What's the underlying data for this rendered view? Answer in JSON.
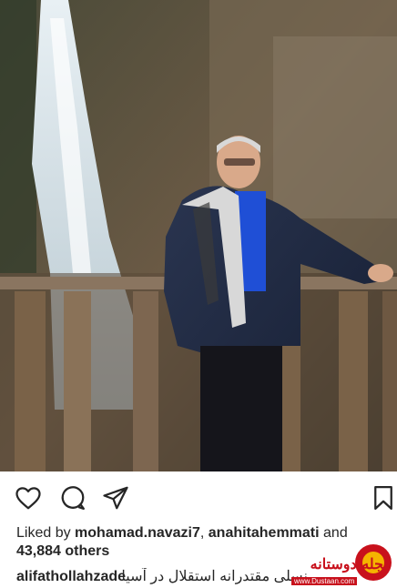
{
  "post": {
    "photo": {
      "alt": "Man standing by a wooden railing in front of a waterfall"
    },
    "actions": {
      "like_icon": "heart-outline-icon",
      "comment_icon": "comment-bubble-icon",
      "share_icon": "paper-plane-icon",
      "save_icon": "bookmark-icon"
    },
    "likes": {
      "prefix": "Liked by ",
      "user1": "mohamad.navazi7",
      "separator": ", ",
      "user2": "anahitahemmati",
      "conjunction": " and",
      "count": "43,884 others"
    },
    "caption": {
      "username": "alifathollahzade",
      "text": "نسلی مقتدرانه استقلال در آسیا"
    },
    "watermark": {
      "brand": "مجله دوستانه",
      "url": "www.Dustaan.com"
    }
  },
  "colors": {
    "text": "#262626",
    "watermark_red": "#c8111c",
    "background": "#ffffff"
  }
}
